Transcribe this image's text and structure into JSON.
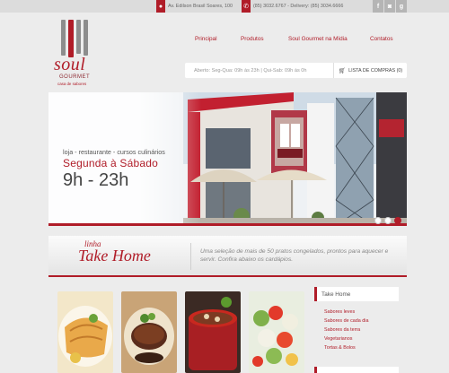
{
  "topbar": {
    "address": "Av. Edilson Brasil Soares, 100",
    "phone": "(85) 3032.6767 - Delivery: (85) 3034.6666",
    "social": [
      {
        "icon": "facebook-icon",
        "glyph": "f"
      },
      {
        "icon": "instagram-icon",
        "glyph": "◙"
      },
      {
        "icon": "google-plus-icon",
        "glyph": "g"
      }
    ]
  },
  "logo": {
    "name": "soul",
    "sub": "GOURMET",
    "tagline": "casa de sabores"
  },
  "nav": {
    "items": [
      "Principal",
      "Produtos",
      "Soul Gourmet na Mídia",
      "Contatos"
    ]
  },
  "info": {
    "hours": "Aberto: Seg-Qua: 09h às 23h | Qui-Sab: 09h às 0h",
    "cart_label": "LISTA DE COMPRAS (0)"
  },
  "hero": {
    "tagline": "loja - restaurante - cursos culinários",
    "days": "Segunda à Sábado",
    "hours": "9h - 23h",
    "slide_count": 3,
    "active_slide": 2
  },
  "takehome": {
    "linha": "linha",
    "title": "Take Home",
    "description": "Uma seleção de mais de 50 pratos congelados, prontos para aquecer e servir. Confira abaixo os cardápios."
  },
  "sidebar": {
    "title": "Take Home",
    "items": [
      "Sabores leves",
      "Sabores de cada dia",
      "Sabores da terra",
      "Vegetarianos",
      "Tortas & Bolos"
    ]
  },
  "colors": {
    "accent": "#b01c28",
    "background": "#ececec",
    "topbar": "#dcdcdc"
  }
}
